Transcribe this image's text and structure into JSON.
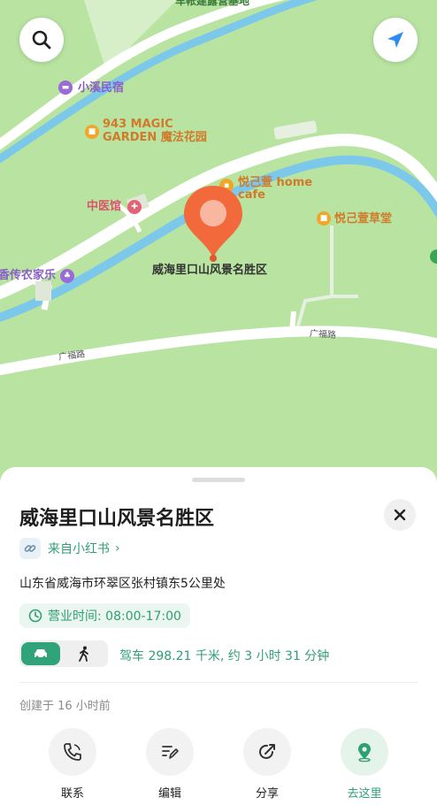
{
  "map": {
    "labels": {
      "top_road": "车帐建露营基地",
      "xiaoxi": "小溪民宿",
      "magic_line1": "943 MAGIC",
      "magic_line2": "GARDEN 魔法花园",
      "yueji_home_line1": "悦己萱 home",
      "yueji_home_line2": "cafe",
      "zhongyi": "中医馆",
      "yueji_caotang": "悦己萱草堂",
      "nongjiale": "香传农家乐",
      "selected_place": "威海里口山风景名胜区",
      "road_1": "广福路",
      "road_2": "广福路"
    },
    "buttons": {
      "search": "search-icon",
      "locate": "locate-arrow-icon"
    },
    "colors": {
      "land": "#b8e3a0",
      "river": "#7cc8ea",
      "road": "#ffffff",
      "pin": "#f26a3c"
    }
  },
  "sheet": {
    "title": "威海里口山风景名胜区",
    "source_text": "来自小红书",
    "address": "山东省威海市环翠区张村镇东5公里处",
    "hours": "营业时间: 08:00-17:00",
    "drive_info": "驾车 298.21 千米, 约 3 小时 31 分钟",
    "created": "创建于 16 小时前",
    "actions": [
      {
        "label": "联系"
      },
      {
        "label": "编辑"
      },
      {
        "label": "分享"
      },
      {
        "label": "去这里"
      }
    ],
    "accent": "#2f9f74"
  }
}
